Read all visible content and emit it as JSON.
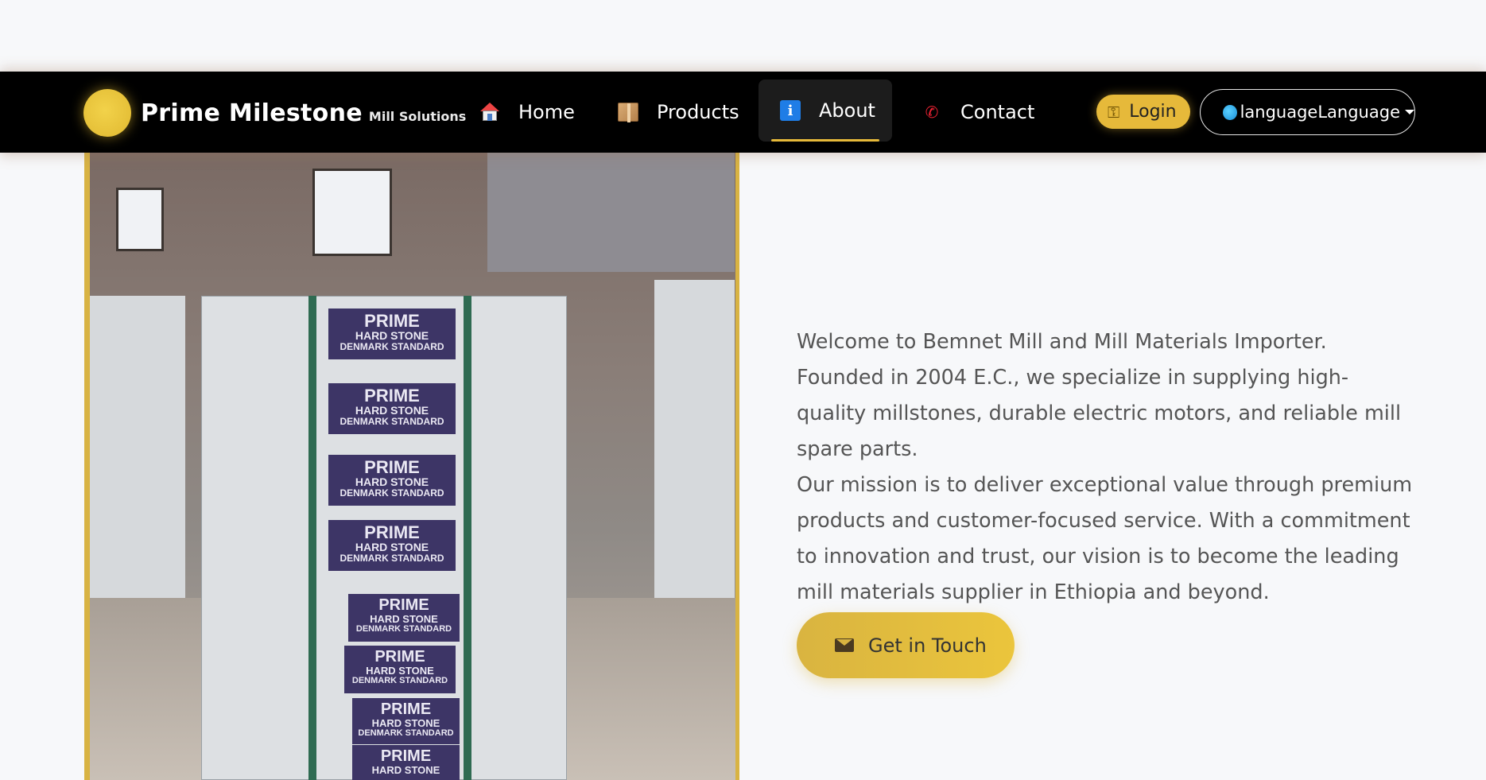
{
  "navbar": {
    "brand_name": "Prime Milestone",
    "brand_sub": "Mill Solutions",
    "items": [
      {
        "label": "Home",
        "icon": "house-icon"
      },
      {
        "label": "Products",
        "icon": "package-icon"
      },
      {
        "label": "About",
        "icon": "info-icon",
        "active": true
      },
      {
        "label": "Contact",
        "icon": "phone-icon"
      }
    ],
    "login_label": "Login",
    "login_icon": "key-icon",
    "language_label": "languageLanguage",
    "accent_color": "#e6b93a"
  },
  "photo": {
    "label_lines": [
      "PRIME",
      "HARD STONE",
      "DENMARK STANDARD"
    ]
  },
  "about": {
    "paragraph1": "Welcome to Bemnet Mill and Mill Materials Importer. Founded in 2004 E.C., we specialize in supplying high-quality millstones, durable electric motors, and reliable mill spare parts.",
    "paragraph2": "Our mission is to deliver exceptional value through premium products and customer-focused service. With a commitment to innovation and trust, our vision is to become the leading mill materials supplier in Ethiopia and beyond.",
    "cta_label": "Get in Touch",
    "cta_icon": "envelope-icon"
  }
}
